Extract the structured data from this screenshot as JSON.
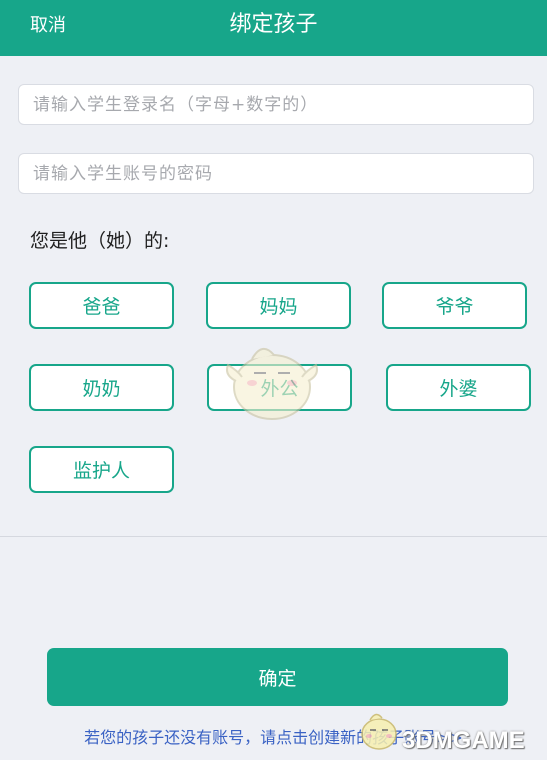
{
  "header": {
    "cancel_label": "取消",
    "title": "绑定孩子",
    "background_color": "#17a68a"
  },
  "form": {
    "username": {
      "placeholder": "请输入学生登录名（字母+数字的）",
      "value": ""
    },
    "password": {
      "placeholder": "请输入学生账号的密码",
      "value": ""
    }
  },
  "relation": {
    "label": "您是他（她）的:",
    "options": [
      {
        "label": "爸爸"
      },
      {
        "label": "妈妈"
      },
      {
        "label": "爷爷"
      },
      {
        "label": "奶奶"
      },
      {
        "label": "外公"
      },
      {
        "label": "外婆"
      },
      {
        "label": "监护人"
      }
    ],
    "accent_color": "#17a68a"
  },
  "confirm": {
    "label": "确定"
  },
  "footer": {
    "create_link": "若您的孩子还没有账号，请点击创建新的孩子账号>>"
  },
  "watermark": {
    "text": "3DMGAME",
    "icon": "chick-mascot-icon"
  }
}
